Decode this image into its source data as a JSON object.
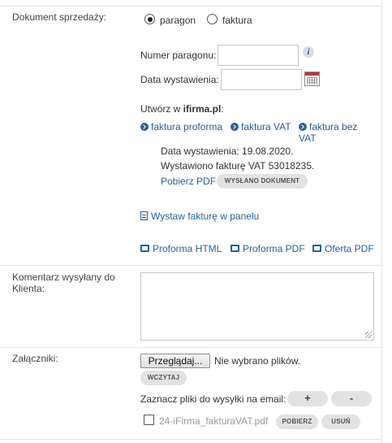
{
  "sale_document": {
    "label": "Dokument sprzedaży:",
    "options": [
      {
        "label": "paragon",
        "selected": true
      },
      {
        "label": "faktura",
        "selected": false
      }
    ]
  },
  "receipt_number": {
    "label": "Numer paragonu:",
    "value": "",
    "info_icon": "i"
  },
  "issue_date": {
    "label": "Data wystawienia:",
    "value": ""
  },
  "ifirma": {
    "create_prefix": "Utwórz w ",
    "brand": "ifirma.pl",
    "create_suffix": ":",
    "links": [
      "faktura proforma",
      "faktura VAT",
      "faktura bez VAT"
    ],
    "issue_date_text": "Data wystawienia: 19.08.2020.",
    "invoice_text": "Wystawiono fakturę VAT 53018235.",
    "download_pdf": "Pobierz PDF",
    "sent_badge": "WYSŁANO DOKUMENT",
    "issue_in_panel": "Wystaw fakturę w panelu",
    "print_links": [
      "Proforma HTML",
      "Proforma PDF",
      "Oferta PDF"
    ]
  },
  "comment": {
    "label": "Komentarz wysyłany do Klienta:",
    "value": ""
  },
  "attachments": {
    "label": "Załączniki:",
    "browse_button": "Przeglądaj...",
    "no_files": "Nie wybrano plików.",
    "load_button": "WCZYTAJ",
    "select_label": "Zaznacz pliki do wysyłki na email:",
    "plus": "+",
    "minus": "-",
    "files": [
      {
        "name": "24-iFirma_fakturaVAT.pdf",
        "checked": false,
        "download": "POBIERZ",
        "delete": "USUŃ"
      }
    ]
  },
  "colors": {
    "link": "#2b5f96",
    "badge_bg": "#e2e2e2",
    "text": "#333333"
  }
}
